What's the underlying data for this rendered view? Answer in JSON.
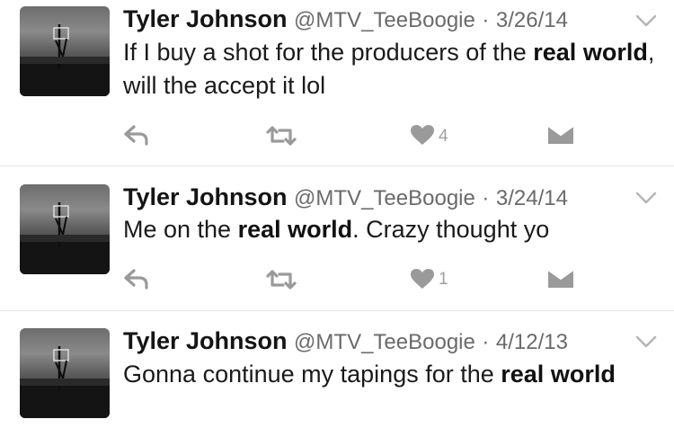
{
  "tweets": [
    {
      "name": "Tyler Johnson",
      "handle": "@MTV_TeeBoogie",
      "separator": "·",
      "date": "3/26/14",
      "text": {
        "p1": "If I buy a shot for the producers of the ",
        "b1": "real",
        "p2": " ",
        "b2": "world",
        "p3": ", will the accept it lol"
      },
      "like_count": "4"
    },
    {
      "name": "Tyler Johnson",
      "handle": "@MTV_TeeBoogie",
      "separator": "·",
      "date": "3/24/14",
      "text": {
        "p1": "Me on the ",
        "b1": "real world",
        "p2": ". Crazy thought yo"
      },
      "like_count": "1"
    },
    {
      "name": "Tyler Johnson",
      "handle": "@MTV_TeeBoogie",
      "separator": "·",
      "date": "4/12/13",
      "text": {
        "p1": "Gonna continue my tapings for the ",
        "b1": "real",
        "p2": " ",
        "b2": "world"
      }
    }
  ],
  "icons": {
    "reply": "reply-icon",
    "retweet": "retweet-icon",
    "like": "heart-icon",
    "message": "envelope-icon",
    "more": "chevron-down-icon"
  }
}
